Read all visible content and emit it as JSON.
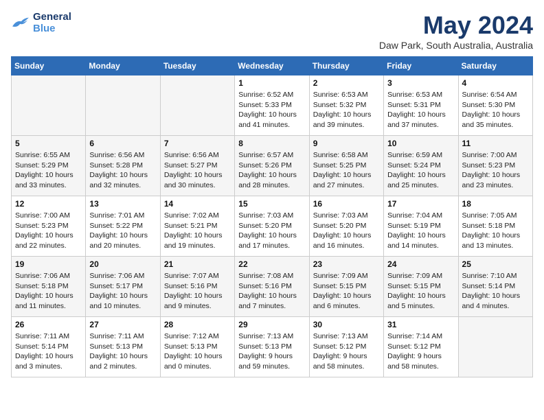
{
  "header": {
    "logo_line1": "General",
    "logo_line2": "Blue",
    "month": "May 2024",
    "location": "Daw Park, South Australia, Australia"
  },
  "weekdays": [
    "Sunday",
    "Monday",
    "Tuesday",
    "Wednesday",
    "Thursday",
    "Friday",
    "Saturday"
  ],
  "weeks": [
    [
      {
        "day": "",
        "info": ""
      },
      {
        "day": "",
        "info": ""
      },
      {
        "day": "",
        "info": ""
      },
      {
        "day": "1",
        "info": "Sunrise: 6:52 AM\nSunset: 5:33 PM\nDaylight: 10 hours\nand 41 minutes."
      },
      {
        "day": "2",
        "info": "Sunrise: 6:53 AM\nSunset: 5:32 PM\nDaylight: 10 hours\nand 39 minutes."
      },
      {
        "day": "3",
        "info": "Sunrise: 6:53 AM\nSunset: 5:31 PM\nDaylight: 10 hours\nand 37 minutes."
      },
      {
        "day": "4",
        "info": "Sunrise: 6:54 AM\nSunset: 5:30 PM\nDaylight: 10 hours\nand 35 minutes."
      }
    ],
    [
      {
        "day": "5",
        "info": "Sunrise: 6:55 AM\nSunset: 5:29 PM\nDaylight: 10 hours\nand 33 minutes."
      },
      {
        "day": "6",
        "info": "Sunrise: 6:56 AM\nSunset: 5:28 PM\nDaylight: 10 hours\nand 32 minutes."
      },
      {
        "day": "7",
        "info": "Sunrise: 6:56 AM\nSunset: 5:27 PM\nDaylight: 10 hours\nand 30 minutes."
      },
      {
        "day": "8",
        "info": "Sunrise: 6:57 AM\nSunset: 5:26 PM\nDaylight: 10 hours\nand 28 minutes."
      },
      {
        "day": "9",
        "info": "Sunrise: 6:58 AM\nSunset: 5:25 PM\nDaylight: 10 hours\nand 27 minutes."
      },
      {
        "day": "10",
        "info": "Sunrise: 6:59 AM\nSunset: 5:24 PM\nDaylight: 10 hours\nand 25 minutes."
      },
      {
        "day": "11",
        "info": "Sunrise: 7:00 AM\nSunset: 5:23 PM\nDaylight: 10 hours\nand 23 minutes."
      }
    ],
    [
      {
        "day": "12",
        "info": "Sunrise: 7:00 AM\nSunset: 5:23 PM\nDaylight: 10 hours\nand 22 minutes."
      },
      {
        "day": "13",
        "info": "Sunrise: 7:01 AM\nSunset: 5:22 PM\nDaylight: 10 hours\nand 20 minutes."
      },
      {
        "day": "14",
        "info": "Sunrise: 7:02 AM\nSunset: 5:21 PM\nDaylight: 10 hours\nand 19 minutes."
      },
      {
        "day": "15",
        "info": "Sunrise: 7:03 AM\nSunset: 5:20 PM\nDaylight: 10 hours\nand 17 minutes."
      },
      {
        "day": "16",
        "info": "Sunrise: 7:03 AM\nSunset: 5:20 PM\nDaylight: 10 hours\nand 16 minutes."
      },
      {
        "day": "17",
        "info": "Sunrise: 7:04 AM\nSunset: 5:19 PM\nDaylight: 10 hours\nand 14 minutes."
      },
      {
        "day": "18",
        "info": "Sunrise: 7:05 AM\nSunset: 5:18 PM\nDaylight: 10 hours\nand 13 minutes."
      }
    ],
    [
      {
        "day": "19",
        "info": "Sunrise: 7:06 AM\nSunset: 5:18 PM\nDaylight: 10 hours\nand 11 minutes."
      },
      {
        "day": "20",
        "info": "Sunrise: 7:06 AM\nSunset: 5:17 PM\nDaylight: 10 hours\nand 10 minutes."
      },
      {
        "day": "21",
        "info": "Sunrise: 7:07 AM\nSunset: 5:16 PM\nDaylight: 10 hours\nand 9 minutes."
      },
      {
        "day": "22",
        "info": "Sunrise: 7:08 AM\nSunset: 5:16 PM\nDaylight: 10 hours\nand 7 minutes."
      },
      {
        "day": "23",
        "info": "Sunrise: 7:09 AM\nSunset: 5:15 PM\nDaylight: 10 hours\nand 6 minutes."
      },
      {
        "day": "24",
        "info": "Sunrise: 7:09 AM\nSunset: 5:15 PM\nDaylight: 10 hours\nand 5 minutes."
      },
      {
        "day": "25",
        "info": "Sunrise: 7:10 AM\nSunset: 5:14 PM\nDaylight: 10 hours\nand 4 minutes."
      }
    ],
    [
      {
        "day": "26",
        "info": "Sunrise: 7:11 AM\nSunset: 5:14 PM\nDaylight: 10 hours\nand 3 minutes."
      },
      {
        "day": "27",
        "info": "Sunrise: 7:11 AM\nSunset: 5:13 PM\nDaylight: 10 hours\nand 2 minutes."
      },
      {
        "day": "28",
        "info": "Sunrise: 7:12 AM\nSunset: 5:13 PM\nDaylight: 10 hours\nand 0 minutes."
      },
      {
        "day": "29",
        "info": "Sunrise: 7:13 AM\nSunset: 5:13 PM\nDaylight: 9 hours\nand 59 minutes."
      },
      {
        "day": "30",
        "info": "Sunrise: 7:13 AM\nSunset: 5:12 PM\nDaylight: 9 hours\nand 58 minutes."
      },
      {
        "day": "31",
        "info": "Sunrise: 7:14 AM\nSunset: 5:12 PM\nDaylight: 9 hours\nand 58 minutes."
      },
      {
        "day": "",
        "info": ""
      }
    ]
  ]
}
